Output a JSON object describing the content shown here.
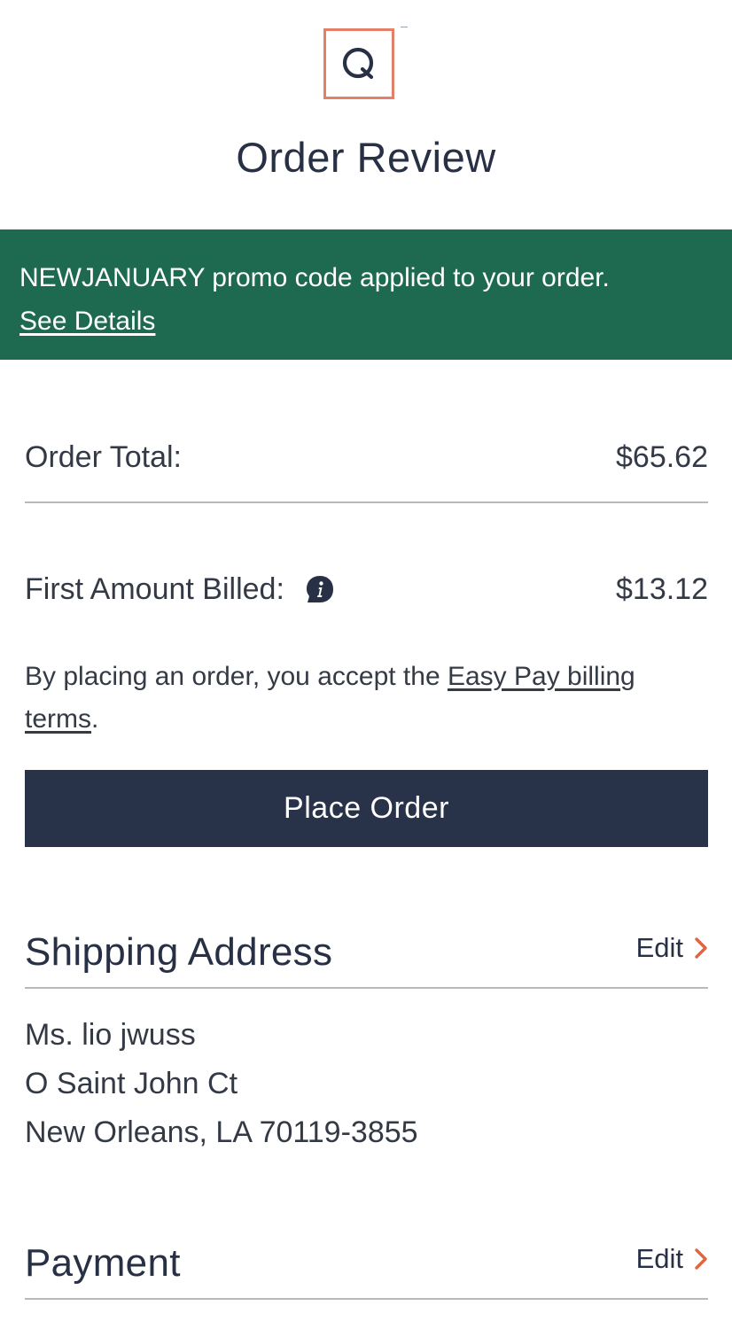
{
  "header": {
    "title": "Order Review"
  },
  "promo": {
    "code": "NEWJANUARY",
    "message": " promo code applied to your order.",
    "link_label": "See Details"
  },
  "summary": {
    "order_total_label": "Order Total:",
    "order_total_value": "$65.62",
    "first_billed_label": "First Amount Billed:",
    "first_billed_value": "$13.12",
    "terms_prefix": "By placing an order, you accept the ",
    "terms_link": "Easy Pay billing terms",
    "terms_suffix": "."
  },
  "actions": {
    "place_order_label": "Place Order"
  },
  "shipping": {
    "title": "Shipping Address",
    "edit_label": "Edit",
    "address_lines": [
      "Ms. lio jwuss",
      "O Saint John Ct",
      "New Orleans, LA 70119-3855"
    ]
  },
  "payment": {
    "title": "Payment",
    "edit_label": "Edit"
  },
  "colors": {
    "promo_bg": "#1e6a51",
    "button_bg": "#283248",
    "accent": "#e0643f",
    "logo_border": "#e58068"
  },
  "icons": {
    "logo": "qvc-q-logo-icon",
    "info": "info-icon",
    "chevron": "chevron-right-icon"
  }
}
